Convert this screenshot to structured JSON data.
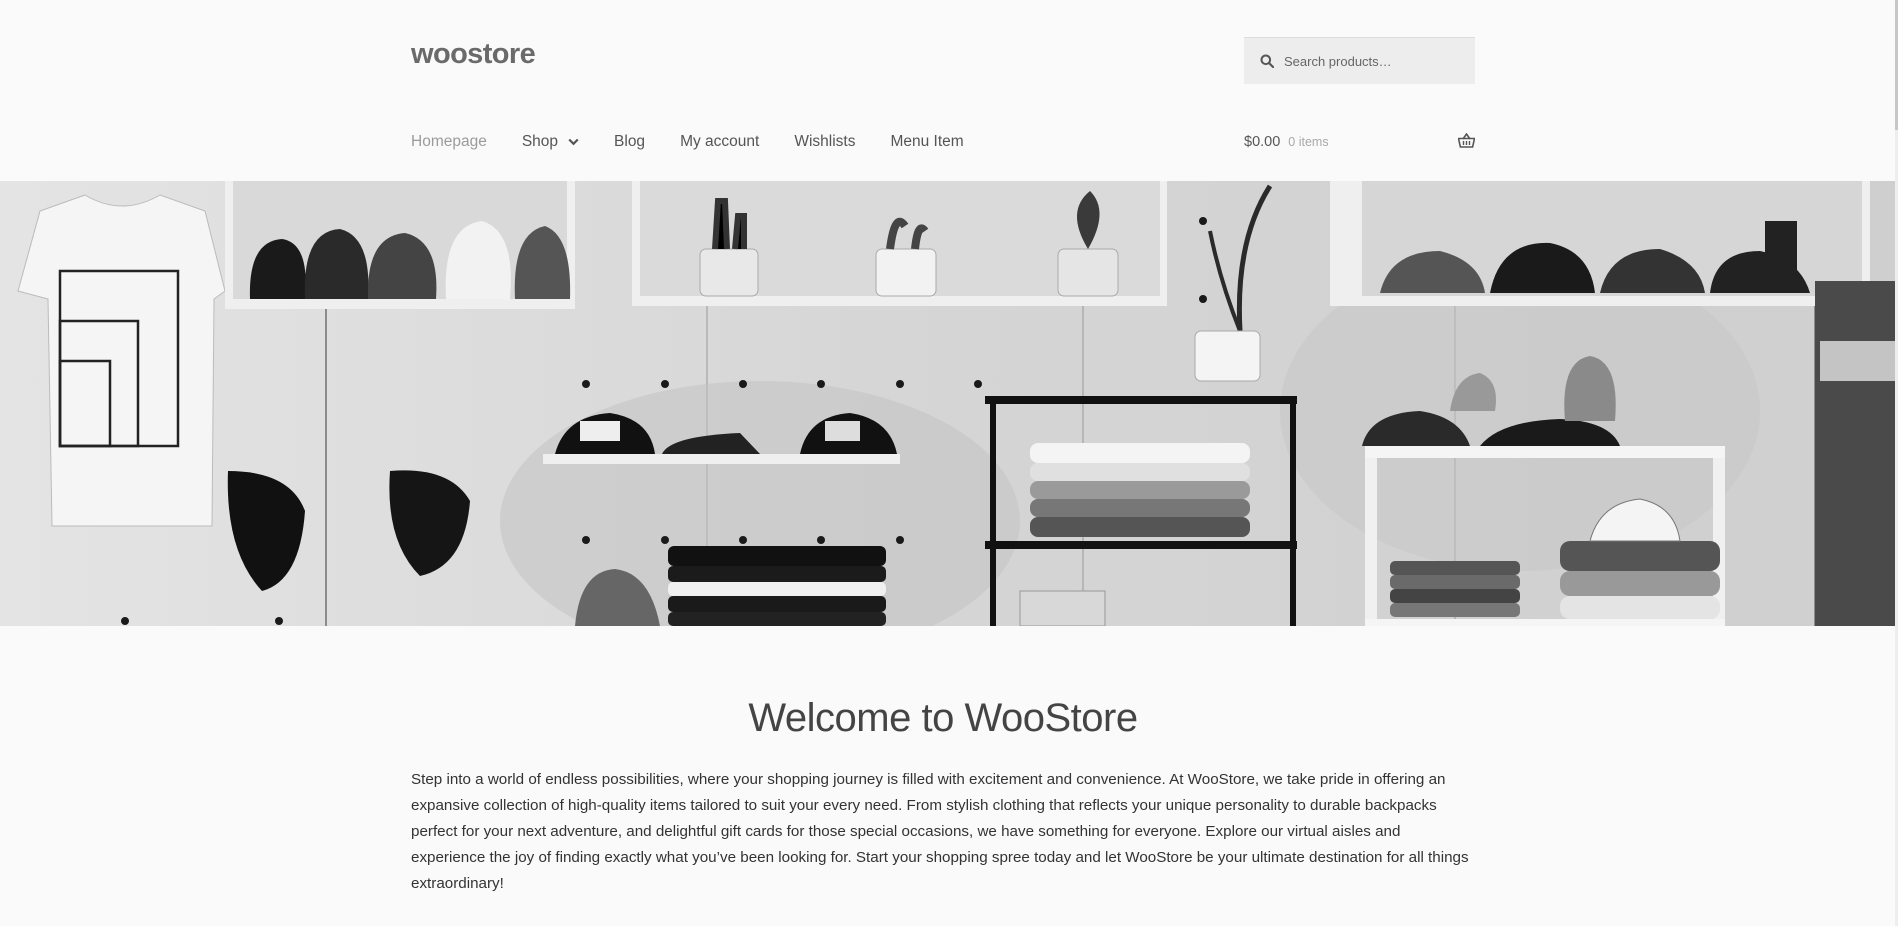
{
  "site": {
    "title": "woostore"
  },
  "search": {
    "placeholder": "Search products…"
  },
  "nav": {
    "items": [
      {
        "label": "Homepage",
        "state": "current"
      },
      {
        "label": "Shop",
        "has_dropdown": true
      },
      {
        "label": "Blog"
      },
      {
        "label": "My account"
      },
      {
        "label": "Wishlists"
      },
      {
        "label": "Menu Item"
      }
    ]
  },
  "cart": {
    "amount": "$0.00",
    "count": "0 items",
    "icon": "basket-icon"
  },
  "hero": {
    "image": "store-interior-shelves-photo"
  },
  "welcome": {
    "title": "Welcome to WooStore",
    "body": "Step into a world of endless possibilities, where your shopping journey is filled with excitement and convenience. At WooStore, we take pride in offering an expansive collection of high-quality items tailored to suit your every need. From stylish clothing that reflects your unique personality to durable backpacks perfect for your next adventure, and delightful gift cards for those special occasions, we have something for everyone. Explore our virtual aisles and experience the joy of finding exactly what you’ve been looking for. Start your shopping spree today and let WooStore be your ultimate destination for all things extraordinary!"
  },
  "colors": {
    "background": "#fafafa",
    "text": "#333333",
    "muted": "#9b9b9b"
  }
}
